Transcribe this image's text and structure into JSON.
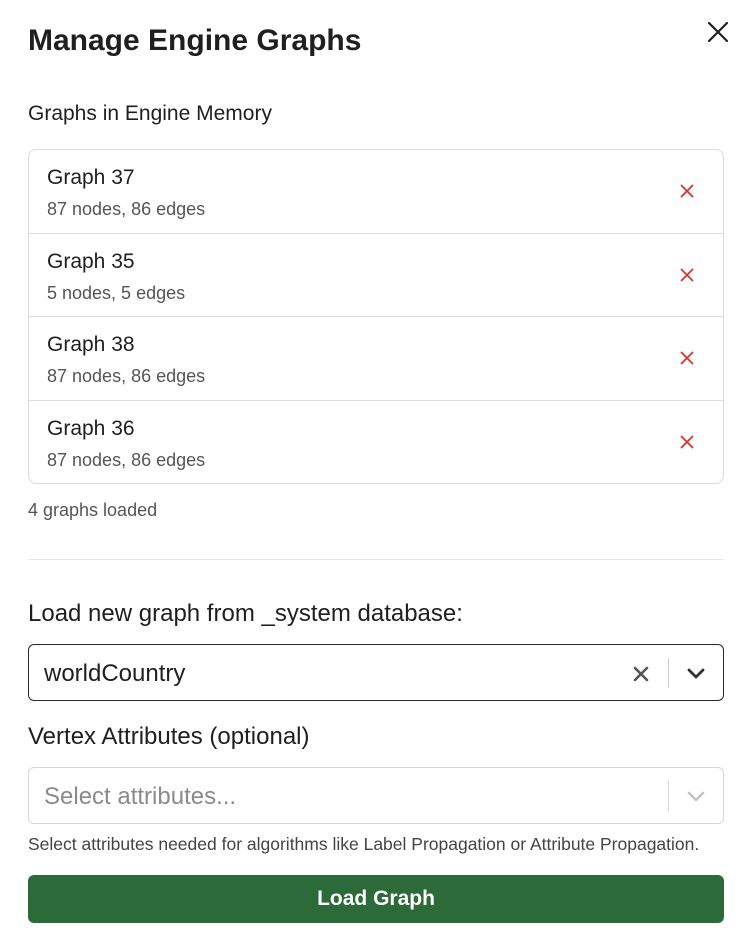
{
  "modal": {
    "title": "Manage Engine Graphs"
  },
  "memory": {
    "label": "Graphs in Engine Memory",
    "graphs": [
      {
        "name": "Graph 37",
        "meta": "87 nodes, 86 edges"
      },
      {
        "name": "Graph 35",
        "meta": "5 nodes, 5 edges"
      },
      {
        "name": "Graph 38",
        "meta": "87 nodes, 86 edges"
      },
      {
        "name": "Graph 36",
        "meta": "87 nodes, 86 edges"
      }
    ],
    "count_text": "4 graphs loaded"
  },
  "load": {
    "label": "Load new graph from _system database:",
    "selected_graph": "worldCountry"
  },
  "vertex": {
    "label": "Vertex Attributes (optional)",
    "placeholder": "Select attributes...",
    "help": "Select attributes needed for algorithms like Label Propagation or Attribute Propagation."
  },
  "actions": {
    "load_button": "Load Graph"
  },
  "colors": {
    "remove_icon": "#d9342b",
    "primary_button": "#2d6a3a"
  },
  "icons": {
    "close": "close-icon",
    "remove": "x-icon",
    "clear": "clear-icon",
    "dropdown": "chevron-down-icon"
  }
}
